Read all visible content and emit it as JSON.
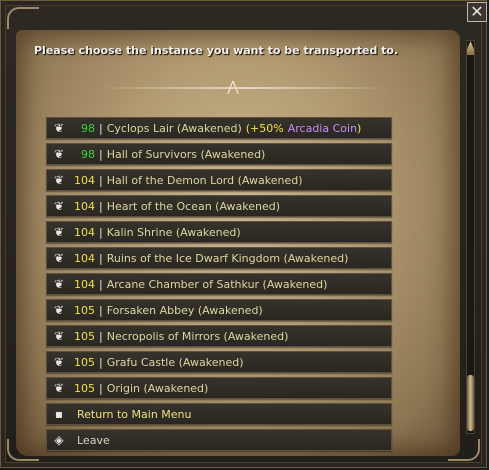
{
  "dialog": {
    "prompt": "Please choose the instance you want to be transported to.",
    "close_icon": "close-icon"
  },
  "instances": [
    {
      "level": "98",
      "level_color": "green",
      "name": "Cyclops Lair (Awakened)",
      "bonus_prefix": "(+50%",
      "bonus_coin": "Arcadia Coin",
      "bonus_suffix": ")"
    },
    {
      "level": "98",
      "level_color": "green",
      "name": "Hall of Survivors (Awakened)"
    },
    {
      "level": "104",
      "level_color": "yellow",
      "name": "Hall of the Demon Lord (Awakened)"
    },
    {
      "level": "104",
      "level_color": "yellow",
      "name": "Heart of the Ocean (Awakened)"
    },
    {
      "level": "104",
      "level_color": "yellow",
      "name": "Kalin Shrine (Awakened)"
    },
    {
      "level": "104",
      "level_color": "yellow",
      "name": "Ruins of the Ice Dwarf Kingdom (Awakened)"
    },
    {
      "level": "104",
      "level_color": "yellow",
      "name": "Arcane Chamber of Sathkur (Awakened)"
    },
    {
      "level": "105",
      "level_color": "yellow",
      "name": "Forsaken Abbey (Awakened)"
    },
    {
      "level": "105",
      "level_color": "yellow",
      "name": "Necropolis of Mirrors (Awakened)"
    },
    {
      "level": "105",
      "level_color": "yellow",
      "name": "Grafu Castle (Awakened)"
    },
    {
      "level": "105",
      "level_color": "yellow",
      "name": "Origin (Awakened)"
    }
  ],
  "separator": "|",
  "menu": {
    "return_label": "Return to Main Menu",
    "leave_label": "Leave"
  },
  "colors": {
    "level_green": "#3cd23c",
    "level_yellow": "#f0e04a",
    "instance_name": "#dcd6a0",
    "coin": "#c88cf0"
  }
}
